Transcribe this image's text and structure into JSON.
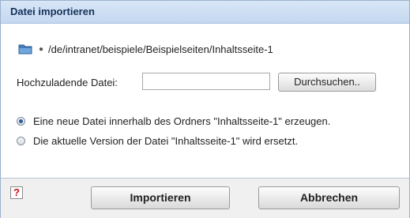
{
  "dialog": {
    "title": "Datei importieren"
  },
  "path": {
    "icon": "folder-icon",
    "bullet": "●",
    "text": "/de/intranet/beispiele/Beispielseiten/Inhaltsseite-1"
  },
  "file": {
    "label": "Hochzuladende Datei:",
    "value": "",
    "browse_label": "Durchsuchen.."
  },
  "options": [
    {
      "label": "Eine neue Datei innerhalb des Ordners \"Inhaltsseite-1\" erzeugen.",
      "checked": true
    },
    {
      "label": "Die aktuelle Version der Datei \"Inhaltsseite-1\" wird ersetzt.",
      "checked": false
    }
  ],
  "footer": {
    "help_icon": "help-icon",
    "help_glyph": "?",
    "import_label": "Importieren",
    "cancel_label": "Abbrechen"
  },
  "colors": {
    "titlebar": "#c4d8f0",
    "title_text": "#15315a",
    "radio_dot": "#2d5a9a",
    "help_glyph": "#c8101a"
  }
}
